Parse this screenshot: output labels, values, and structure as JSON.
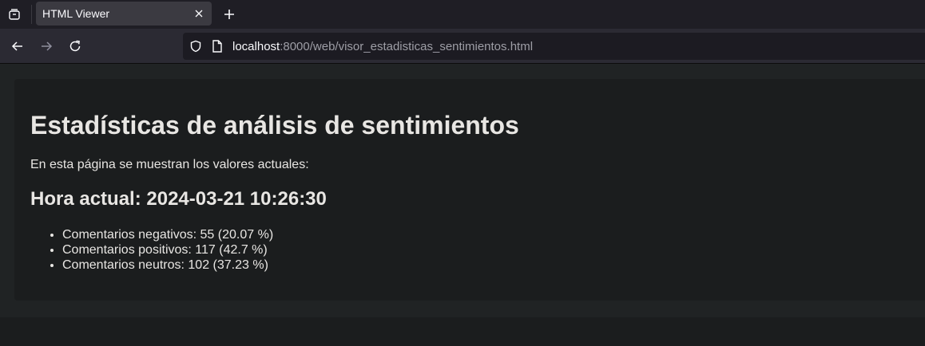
{
  "browser": {
    "tab": {
      "title": "HTML Viewer"
    },
    "url": {
      "host": "localhost",
      "path": ":8000/web/visor_estadisticas_sentimientos.html"
    },
    "icons": {
      "tab_list": "tab-list-icon",
      "close_tab": "close-icon",
      "new_tab": "plus-icon",
      "back": "arrow-left-icon",
      "forward": "arrow-right-icon",
      "reload": "reload-icon",
      "tracking": "shield-icon",
      "page_info": "page-icon"
    }
  },
  "page": {
    "title": "Estadísticas de análisis de sentimientos",
    "intro": "En esta página se muestran los valores actuales:",
    "time_label": "Hora actual: ",
    "time_value": "2024-03-21 10:26:30",
    "stats": [
      "Comentarios negativos: 55 (20.07 %)",
      "Comentarios positivos: 117 (42.7 %)",
      "Comentarios neutros: 102 (37.23 %)"
    ]
  }
}
